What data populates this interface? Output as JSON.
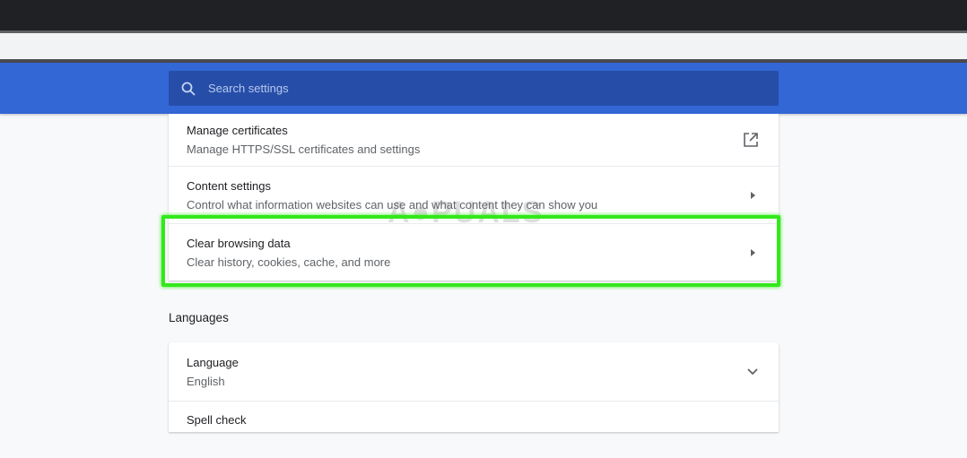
{
  "search": {
    "placeholder": "Search settings"
  },
  "privacy_rows": [
    {
      "title": "Manage certificates",
      "subtitle": "Manage HTTPS/SSL certificates and settings",
      "icon": "open-external-icon"
    },
    {
      "title": "Content settings",
      "subtitle": "Control what information websites can use and what content they can show you",
      "icon": "arrow-right-icon"
    },
    {
      "title": "Clear browsing data",
      "subtitle": "Clear history, cookies, cache, and more",
      "icon": "arrow-right-icon"
    }
  ],
  "languages": {
    "heading": "Languages",
    "rows": [
      {
        "title": "Language",
        "subtitle": "English",
        "icon": "chevron-down-icon"
      },
      {
        "title": "Spell check"
      }
    ]
  },
  "watermark": "APPUALS",
  "colors": {
    "header": "#3367d6",
    "highlight": "#33e81b"
  }
}
